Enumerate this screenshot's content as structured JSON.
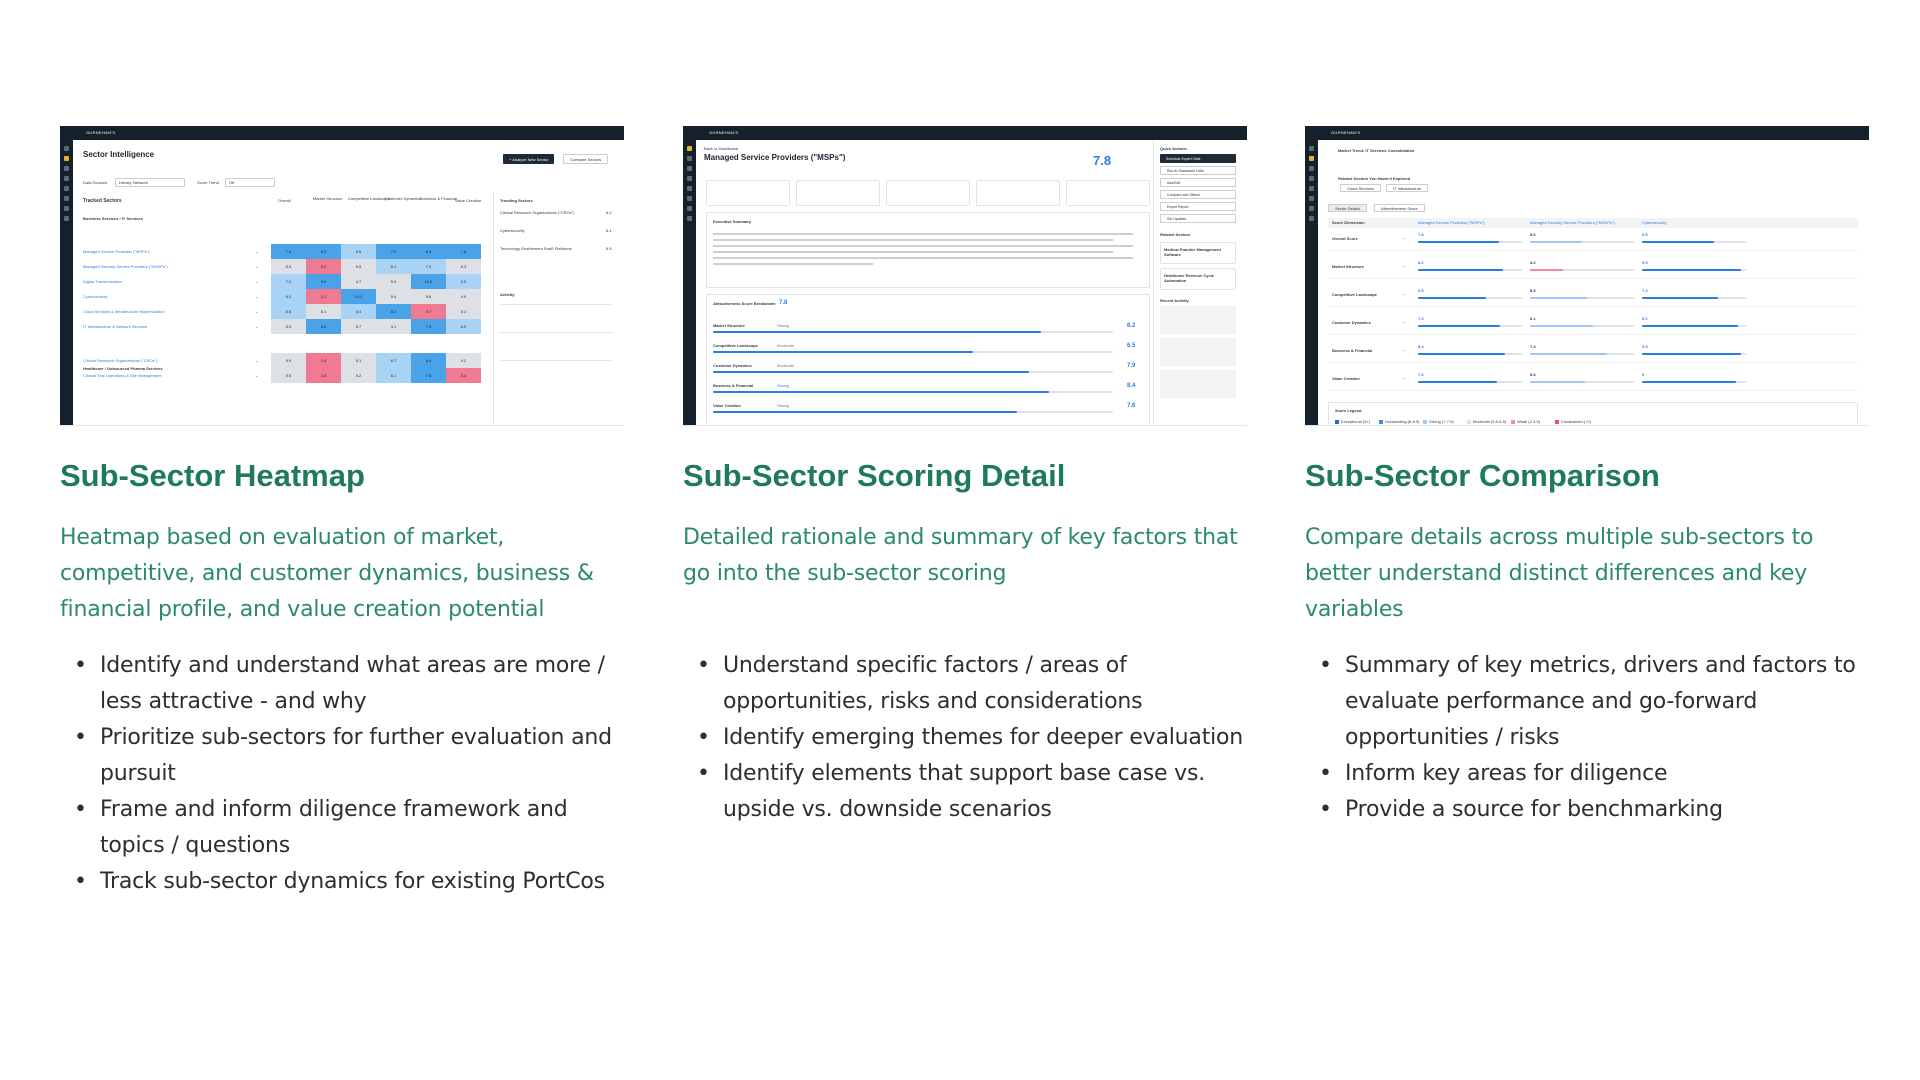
{
  "cards": [
    {
      "title": "Sub-Sector Heatmap",
      "description": "Heatmap based on evaluation of market, competitive, and customer dynamics, business & financial profile, and value creation potential",
      "bullets": [
        "Identify and understand what areas are more / less attractive - and why",
        "Prioritize sub-sectors for further evaluation and pursuit",
        "Frame and inform diligence framework and topics / questions",
        "Track sub-sector dynamics for existing PortCos"
      ]
    },
    {
      "title": "Sub-Sector Scoring Detail",
      "description": "Detailed rationale and summary of key factors that go into the sub-sector scoring",
      "bullets": [
        "Understand specific factors / areas of opportunities, risks and considerations",
        "Identify emerging themes for deeper evaluation",
        "Identify elements that support base case vs. upside vs. downside scenarios"
      ]
    },
    {
      "title": "Sub-Sector Comparison",
      "description": "Compare details across multiple sub-sectors to better understand distinct differences and key variables",
      "bullets": [
        "Summary of key metrics, drivers and factors to evaluate performance and go-forward opportunities / risks",
        "Inform key areas for diligence",
        "Provide a source for benchmarking"
      ]
    }
  ],
  "shot1": {
    "brand": "GURNEHAN'S",
    "page_title": "Sector Intelligence",
    "primary_button": "+ Analyze New Sector",
    "secondary_button": "Compare Sectors",
    "data_sources_label": "Data Sources",
    "data_sources_value": "Library, Network",
    "score_trend_label": "Score Trend",
    "score_trend_value": "Off",
    "tracked_header": "Tracked Sectors",
    "columns": [
      "Overall",
      "Market Structure",
      "Competitive Landscape",
      "Customer Dynamics",
      "Business & Financial",
      "Value Creation"
    ],
    "group_1": "Business Services / IT Services",
    "group_2": "Healthcare / Outsourced Pharma Services",
    "rows": [
      {
        "name": "Managed Service Providers (\"MSPs\")",
        "values": [
          "7.8",
          "8.2",
          "6.5",
          "7.9",
          "8.4",
          "7.6"
        ]
      },
      {
        "name": "Managed Security Service Providers (\"MSSPs\")",
        "values": [
          "5.0",
          "3.2",
          "5.5",
          "6.1",
          "7.4",
          "5.3"
        ]
      },
      {
        "name": "Digital Transformation",
        "values": [
          "7.2",
          "9.6",
          "4.7",
          "5.9",
          "10.0",
          "6.5"
        ]
      },
      {
        "name": "Cybersecurity",
        "values": [
          "6.3",
          "2.1",
          "10.2",
          "5.4",
          "5.6",
          "4.9"
        ]
      },
      {
        "name": "Cloud Services & Infrastructure Modernization",
        "values": [
          "6.8",
          "5.1",
          "6.4",
          "8.3",
          "3.7",
          "5.2"
        ]
      },
      {
        "name": "IT Infrastructure & Network Services",
        "values": [
          "5.0",
          "8.6",
          "5.7",
          "4.1",
          "7.5",
          "6.9"
        ]
      },
      {
        "name": "Clinical Research Organizations (\"CROs\")",
        "values": [
          "5.9",
          "2.4",
          "5.1",
          "6.7",
          "8.9",
          "4.2"
        ]
      },
      {
        "name": "Clinical Trial Operations & Site Management",
        "values": [
          "5.6",
          "2.8",
          "5.2",
          "6.1",
          "7.8",
          "3.4"
        ]
      }
    ],
    "trending_header": "Trending Sectors",
    "trending": [
      {
        "name": "Clinical Research Organizations (\"CROs\")",
        "score": "8.2"
      },
      {
        "name": "Cybersecurity",
        "score": "8.1"
      },
      {
        "name": "Technology Enablement SaaS Platforms",
        "score": "8.5"
      }
    ],
    "activity_header": "Activity"
  },
  "shot2": {
    "back_link": "Back to Dashboard",
    "page_title": "Managed Service Providers (\"MSPs\")",
    "overall_score": "7.8",
    "summary_header": "Executive Summary",
    "breakdown_header": "Attractiveness Score Breakdown",
    "breakdown_score": "7.8",
    "dimensions": [
      {
        "name": "Market Structure",
        "tag": "Strong",
        "score": "8.2"
      },
      {
        "name": "Competitive Landscape",
        "tag": "Moderate",
        "score": "6.5"
      },
      {
        "name": "Customer Dynamics",
        "tag": "Moderate",
        "score": "7.9"
      },
      {
        "name": "Business & Financial",
        "tag": "Strong",
        "score": "8.4"
      },
      {
        "name": "Value Creation",
        "tag": "Strong",
        "score": "7.6"
      }
    ],
    "quick_actions_header": "Quick Actions",
    "quick_actions": [
      "Schedule Expert Calls",
      "Run AI Shadowed Calls",
      "Add/Edit",
      "Compare with Others",
      "Export Report",
      "Set Updates"
    ],
    "related_header": "Related Sectors",
    "related": [
      "Medical Practice Management Software",
      "Healthcare Revenue Cycle Automation"
    ],
    "recent_activity_header": "Recent Activity"
  },
  "shot3": {
    "market_trend": "Market Trend: IT Services Consolidation",
    "related_prompt": "Related Sectors You Haven't Explored",
    "related_chips": [
      "Cloud Services",
      "IT Infrastructure"
    ],
    "tabs": [
      "Sector Details",
      "Attractiveness Score"
    ],
    "columns": [
      "Score Dimension",
      "Managed Service Providers (\"MSPs\")",
      "Managed Security Service Providers (\"MSSPs\")",
      "Cybersecurity"
    ],
    "rows": [
      {
        "name": "Overall Score",
        "values": [
          "7.8",
          "5.0",
          "6.9"
        ]
      },
      {
        "name": "Market Structure",
        "values": [
          "8.2",
          "3.2",
          "9.5"
        ]
      },
      {
        "name": "Competitive Landscape",
        "values": [
          "6.5",
          "5.5",
          "7.3"
        ]
      },
      {
        "name": "Customer Dynamics",
        "values": [
          "7.9",
          "6.1",
          "9.2"
        ]
      },
      {
        "name": "Business & Financial",
        "values": [
          "8.4",
          "7.4",
          "9.5"
        ]
      },
      {
        "name": "Value Creation",
        "values": [
          "7.6",
          "5.3",
          "9"
        ]
      }
    ],
    "legend_header": "Score Legend",
    "legend": [
      "Exceptional (9+)",
      "Outstanding (8-8.9)",
      "Strong (7-7.9)",
      "Moderate (5.5-6.9)",
      "Weak (2-3.9)",
      "Constrained (<2)"
    ]
  },
  "colors": {
    "heading": "#1f7a5c",
    "description": "#2b8a68",
    "navy": "#14202b",
    "accent_blue": "#2a7de1",
    "heat_strong": "#4aa3e8",
    "heat_mid": "#a8d3f5",
    "heat_neutral": "#dde1e5",
    "heat_weak": "#f07a91"
  }
}
